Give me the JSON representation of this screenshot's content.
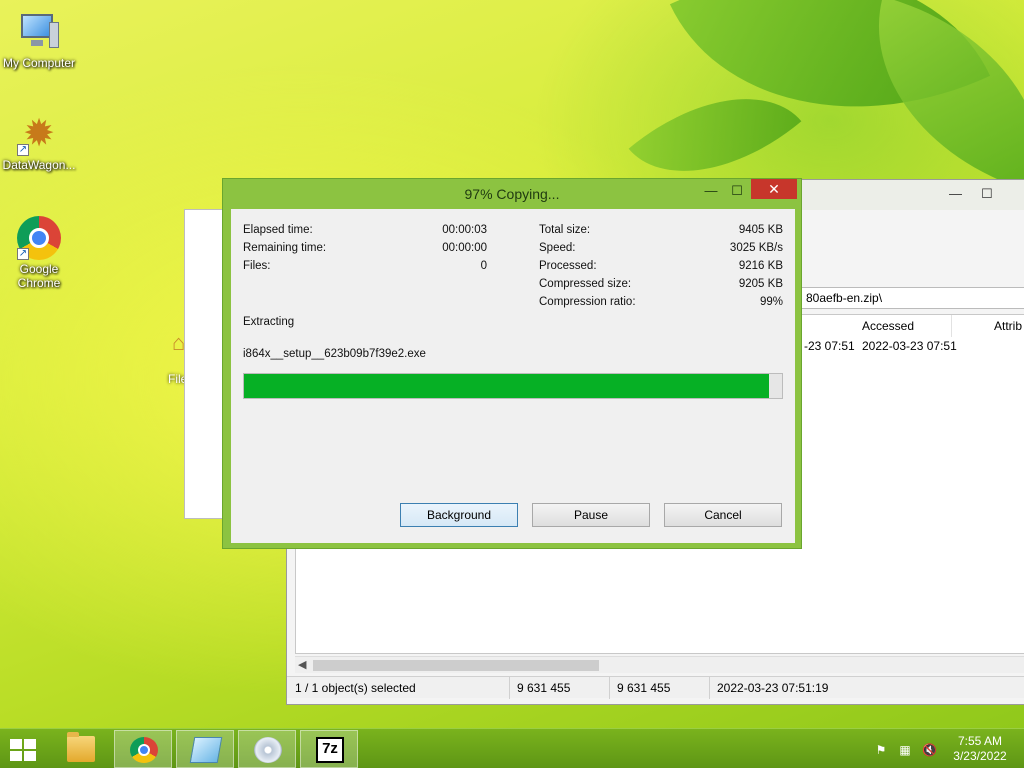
{
  "desktop": {
    "icons": [
      {
        "label": "My Computer"
      },
      {
        "label": "DataWagon..."
      },
      {
        "label": "Google Chrome"
      }
    ],
    "partial_label": "File"
  },
  "explorer": {
    "address": "80aefb-en.zip\\",
    "columns": [
      "Accessed",
      "Attrib"
    ],
    "row": {
      "modified_partial": "-23 07:51",
      "accessed": "2022-03-23 07:51"
    },
    "status": {
      "selected": "1 / 1 object(s) selected",
      "size": "9 631 455",
      "packed": "9 631 455",
      "modified": "2022-03-23 07:51:19"
    }
  },
  "dialog": {
    "title": "97% Copying...",
    "left": [
      {
        "label": "Elapsed time:",
        "value": "00:00:03"
      },
      {
        "label": "Remaining time:",
        "value": "00:00:00"
      },
      {
        "label": "Files:",
        "value": "0"
      }
    ],
    "right": [
      {
        "label": "Total size:",
        "value": "9405 KB"
      },
      {
        "label": "Speed:",
        "value": "3025 KB/s"
      },
      {
        "label": "Processed:",
        "value": "9216 KB"
      },
      {
        "label": "Compressed size:",
        "value": "9205 KB"
      },
      {
        "label": "Compression ratio:",
        "value": "99%"
      }
    ],
    "operation": "Extracting",
    "current_file": "i864x__setup__623b09b7f39e2.exe",
    "progress_fraction": 0.975,
    "buttons": {
      "background": "Background",
      "pause": "Pause",
      "cancel": "Cancel"
    },
    "controls": {
      "minimize": "—",
      "maximize": "☐",
      "close": "✕"
    }
  },
  "taskbar": {
    "sevenzip_label": "7z",
    "time": "7:55 AM",
    "date": "3/23/2022"
  },
  "colors": {
    "progress": "#06b025",
    "dialog_frame": "#8cc341",
    "close_button": "#c7362b",
    "taskbar": "#6ea51a"
  }
}
